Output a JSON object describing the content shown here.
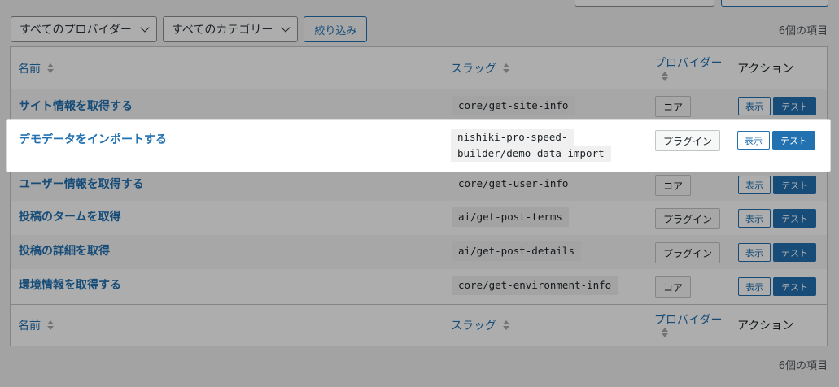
{
  "toolbar": {
    "provider_filter": "すべてのプロバイダー",
    "category_filter": "すべてのカテゴリー",
    "filter_button": "絞り込み"
  },
  "item_count": "6個の項目",
  "columns": {
    "name": "名前",
    "slug": "スラッグ",
    "provider": "プロバイダー",
    "action": "アクション"
  },
  "rows": [
    {
      "name": "サイト情報を取得する",
      "slug": "core/get-site-info",
      "provider": "コア",
      "view": "表示",
      "test": "テスト"
    },
    {
      "name": "デモデータをインポートする",
      "slug_line1": "nishiki-pro-speed-",
      "slug_line2": "builder/demo-data-import",
      "provider": "プラグイン",
      "view": "表示",
      "test": "テスト"
    },
    {
      "name": "ユーザー情報を取得する",
      "slug": "core/get-user-info",
      "provider": "コア",
      "view": "表示",
      "test": "テスト"
    },
    {
      "name": "投稿のタームを取得",
      "slug": "ai/get-post-terms",
      "provider": "プラグイン",
      "view": "表示",
      "test": "テスト"
    },
    {
      "name": "投稿の詳細を取得",
      "slug": "ai/get-post-details",
      "provider": "プラグイン",
      "view": "表示",
      "test": "テスト"
    },
    {
      "name": "環境情報を取得する",
      "slug": "core/get-environment-info",
      "provider": "コア",
      "view": "表示",
      "test": "テスト"
    }
  ],
  "colors": {
    "accent": "#2271b1",
    "overlay": "rgba(0,0,0,0.32)"
  }
}
